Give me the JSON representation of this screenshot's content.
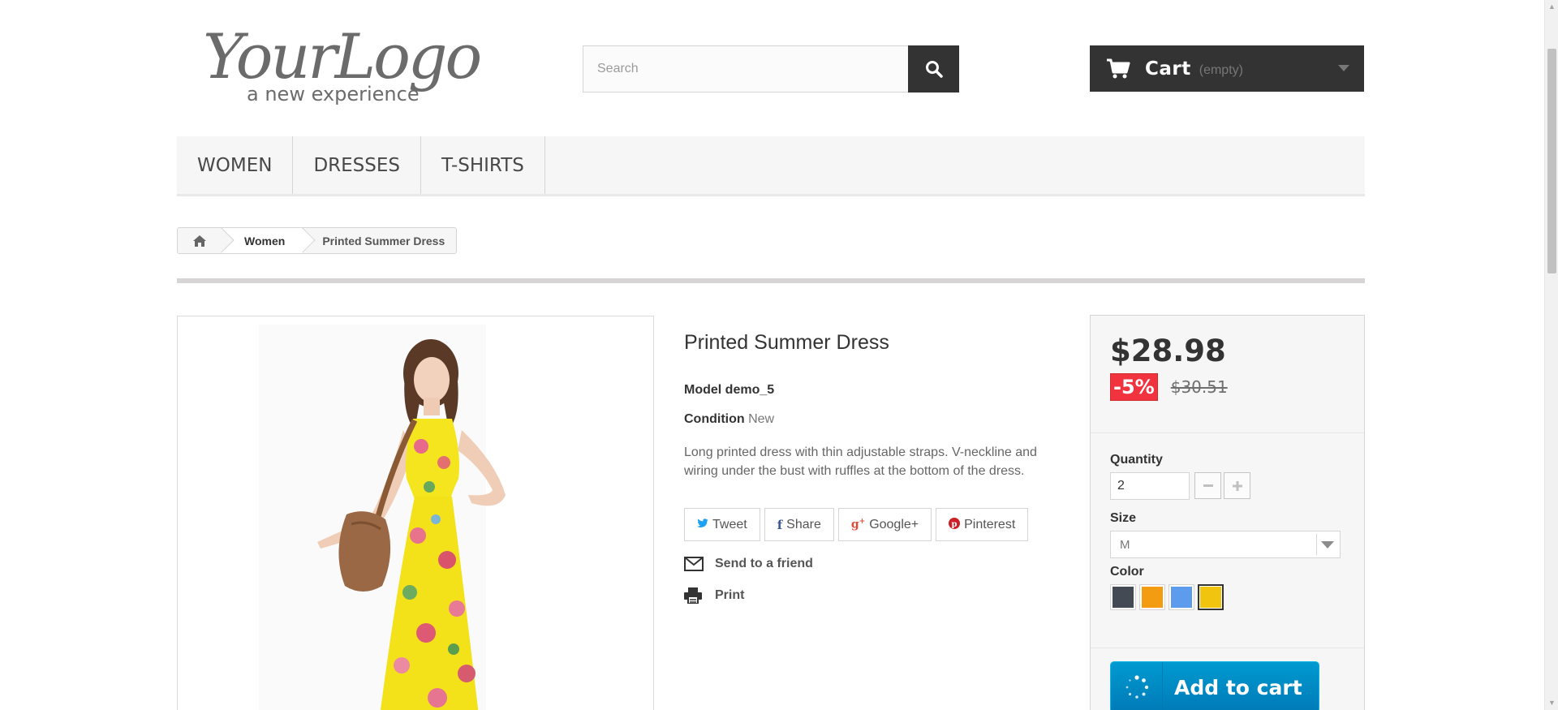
{
  "header": {
    "logo": {
      "main": "YourLogo",
      "tagline": "a new experience"
    },
    "search": {
      "placeholder": "Search",
      "value": ""
    },
    "cart": {
      "label": "Cart",
      "status": "(empty)"
    }
  },
  "menu": {
    "items": [
      {
        "label": "WOMEN"
      },
      {
        "label": "DRESSES"
      },
      {
        "label": "T-SHIRTS"
      }
    ]
  },
  "breadcrumb": {
    "items": [
      {
        "label": "Women"
      },
      {
        "label": "Printed Summer Dress"
      }
    ]
  },
  "product": {
    "title": "Printed Summer Dress",
    "model_label": "Model",
    "model_value": "demo_5",
    "condition_label": "Condition",
    "condition_value": "New",
    "description": "Long printed dress with thin adjustable straps. V-neckline and wiring under the bust with ruffles at the bottom of the dress.",
    "social": [
      {
        "label": "Tweet",
        "icon": "twitter-icon"
      },
      {
        "label": "Share",
        "icon": "facebook-icon"
      },
      {
        "label": "Google+",
        "icon": "google-plus-icon"
      },
      {
        "label": "Pinterest",
        "icon": "pinterest-icon"
      }
    ],
    "send_to_friend": "Send to a friend",
    "print": "Print"
  },
  "buy_box": {
    "price": "$28.98",
    "discount": "-5%",
    "old_price": "$30.51",
    "quantity_label": "Quantity",
    "quantity_value": "2",
    "size_label": "Size",
    "size_value": "M",
    "color_label": "Color",
    "colors": [
      {
        "name": "dark-grey",
        "hex": "#434a54"
      },
      {
        "name": "orange",
        "hex": "#f39c11"
      },
      {
        "name": "blue",
        "hex": "#5d9cec"
      },
      {
        "name": "yellow",
        "hex": "#f1c40f",
        "selected": true
      }
    ],
    "add_to_cart": "Add to cart"
  },
  "colors": {
    "dark": "#333333",
    "discount_red": "#f13340",
    "cart_blue": "#0095cc"
  }
}
